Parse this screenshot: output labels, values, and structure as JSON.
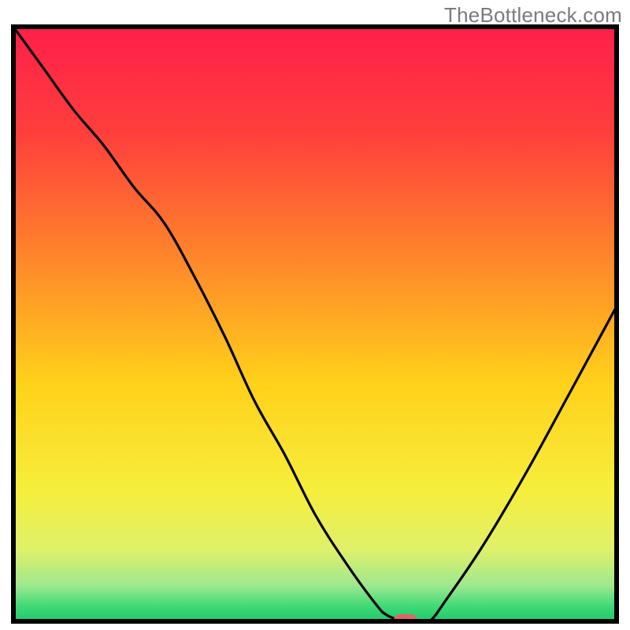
{
  "watermark": "TheBottleneck.com",
  "chart_data": {
    "type": "line",
    "title": "",
    "xlabel": "",
    "ylabel": "",
    "xlim": [
      0,
      100
    ],
    "ylim": [
      0,
      100
    ],
    "x": [
      0,
      5,
      10,
      15,
      20,
      25,
      30,
      35,
      40,
      45,
      50,
      55,
      60,
      62,
      65,
      67,
      69,
      72,
      78,
      85,
      92,
      100
    ],
    "values": [
      100,
      93,
      86,
      80,
      73,
      67,
      58,
      48,
      37,
      28,
      18,
      10,
      3,
      1,
      0,
      0,
      0,
      4,
      13,
      25,
      38,
      53
    ],
    "marker": {
      "x": 65,
      "y": 0,
      "color": "#e06666"
    },
    "gradient_stops": [
      {
        "offset": 0.0,
        "color": "#ff1f4a"
      },
      {
        "offset": 0.18,
        "color": "#ff3f3c"
      },
      {
        "offset": 0.4,
        "color": "#ff8a2a"
      },
      {
        "offset": 0.6,
        "color": "#ffd11a"
      },
      {
        "offset": 0.78,
        "color": "#f6ee3c"
      },
      {
        "offset": 0.88,
        "color": "#dff06a"
      },
      {
        "offset": 0.94,
        "color": "#9ee88f"
      },
      {
        "offset": 0.975,
        "color": "#3fd977"
      },
      {
        "offset": 1.0,
        "color": "#1fc96a"
      }
    ],
    "axes": {
      "outline": true,
      "tick_labels_x": [],
      "tick_labels_y": []
    }
  }
}
